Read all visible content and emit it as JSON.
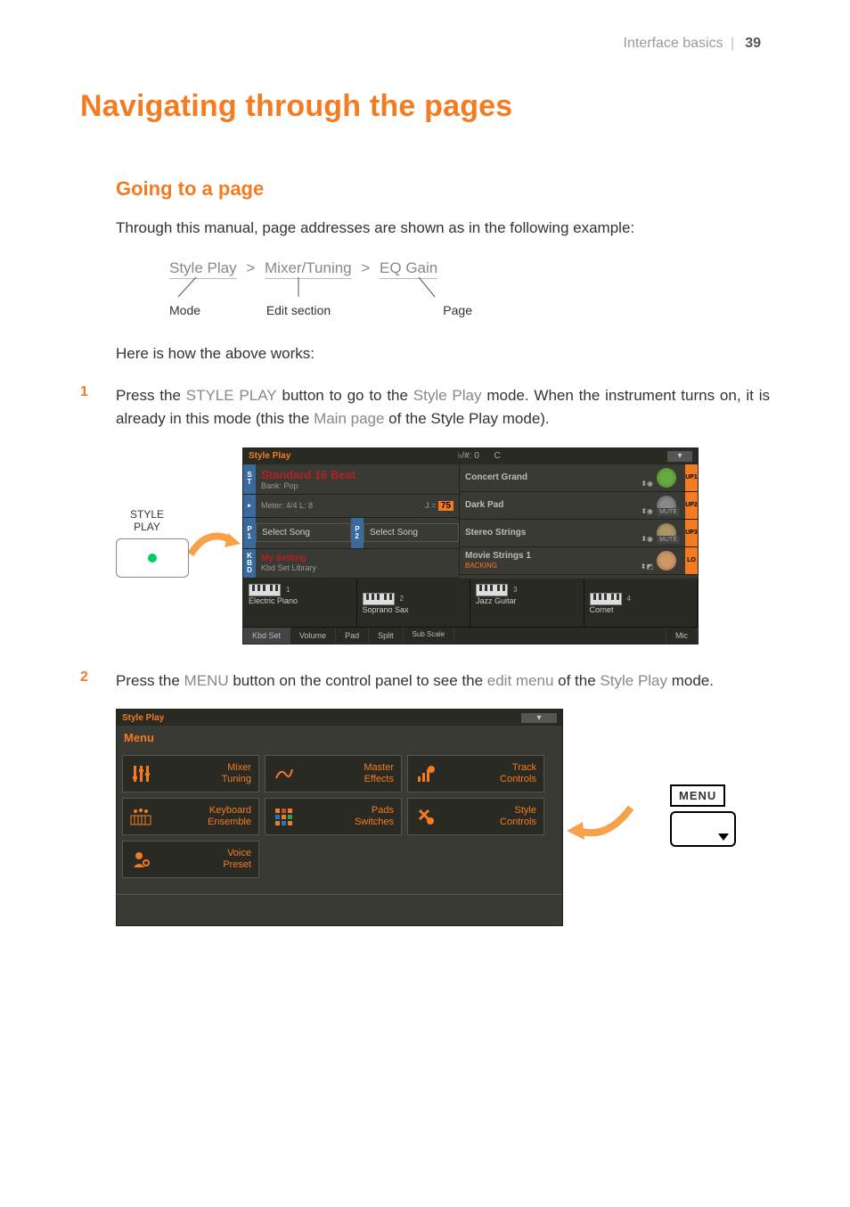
{
  "running_head": {
    "section": "Interface basics",
    "page": "39"
  },
  "h1": "Navigating through the pages",
  "h2": "Going to a page",
  "intro": "Through this manual, page addresses are shown as in the following example:",
  "breadcrumb": {
    "mode": "Style Play",
    "sep": ">",
    "edit": "Mixer/Tuning",
    "page": "EQ Gain",
    "lg_mode": "Mode",
    "lg_edit": "Edit section",
    "lg_page": "Page"
  },
  "here": "Here is how the above works:",
  "step1": {
    "n": "1",
    "p1": "Press the ",
    "sc1": "STYLE PLAY",
    "p2": " button to go to the ",
    "sc2": "Style Play",
    "p3": " mode. When the instrument turns on, it is already in this mode (this the ",
    "sc3": "Main page",
    "p4": " of the Style Play mode)."
  },
  "btn_label": "STYLE PLAY",
  "screen1": {
    "title": "Style Play",
    "key": "♭/#: 0",
    "chord": "C",
    "std": "Standard 16 Beat",
    "bank": "Bank: Pop",
    "meter": "Meter:  4/4  L:    8",
    "tempo_pre": "J = ",
    "tempo": "75",
    "sel": "Select Song",
    "sel2": "Select Song",
    "mset": "My Setting",
    "kbd": "Kbd Set Library",
    "r1": "Concert Grand",
    "r2": "Dark Pad",
    "r3": "Stereo Strings",
    "r4": "Movie Strings 1",
    "r4b": "BACKING",
    "up1": "UP1",
    "up2": "UP2",
    "up3": "UP3",
    "lo": "LO",
    "slot1": "Electric Piano",
    "slot2": "Soprano Sax",
    "slot3": "Jazz Guitar",
    "slot4": "Cornet",
    "s1": "1",
    "s2": "2",
    "s3": "3",
    "s4": "4",
    "tabs": [
      "Kbd Set",
      "Volume",
      "Pad",
      "Split",
      "Sub Scale",
      "",
      "",
      "Mic"
    ]
  },
  "step2": {
    "n": "2",
    "p1": "Press the ",
    "sc1": "MENU",
    "p2": " button on the control panel to see the ",
    "sc2": "edit menu",
    "p3": " of the ",
    "sc3": "Style Play",
    "p4": " mode."
  },
  "screen2": {
    "title": "Style Play",
    "menu": "Menu",
    "b1": "Mixer Tuning",
    "b2": "Master Effects",
    "b3": "Track Controls",
    "b4": "Keyboard Ensemble",
    "b5": "Pads Switches",
    "b6": "Style Controls",
    "b7": "Voice Preset"
  },
  "menu_label": "MENU"
}
